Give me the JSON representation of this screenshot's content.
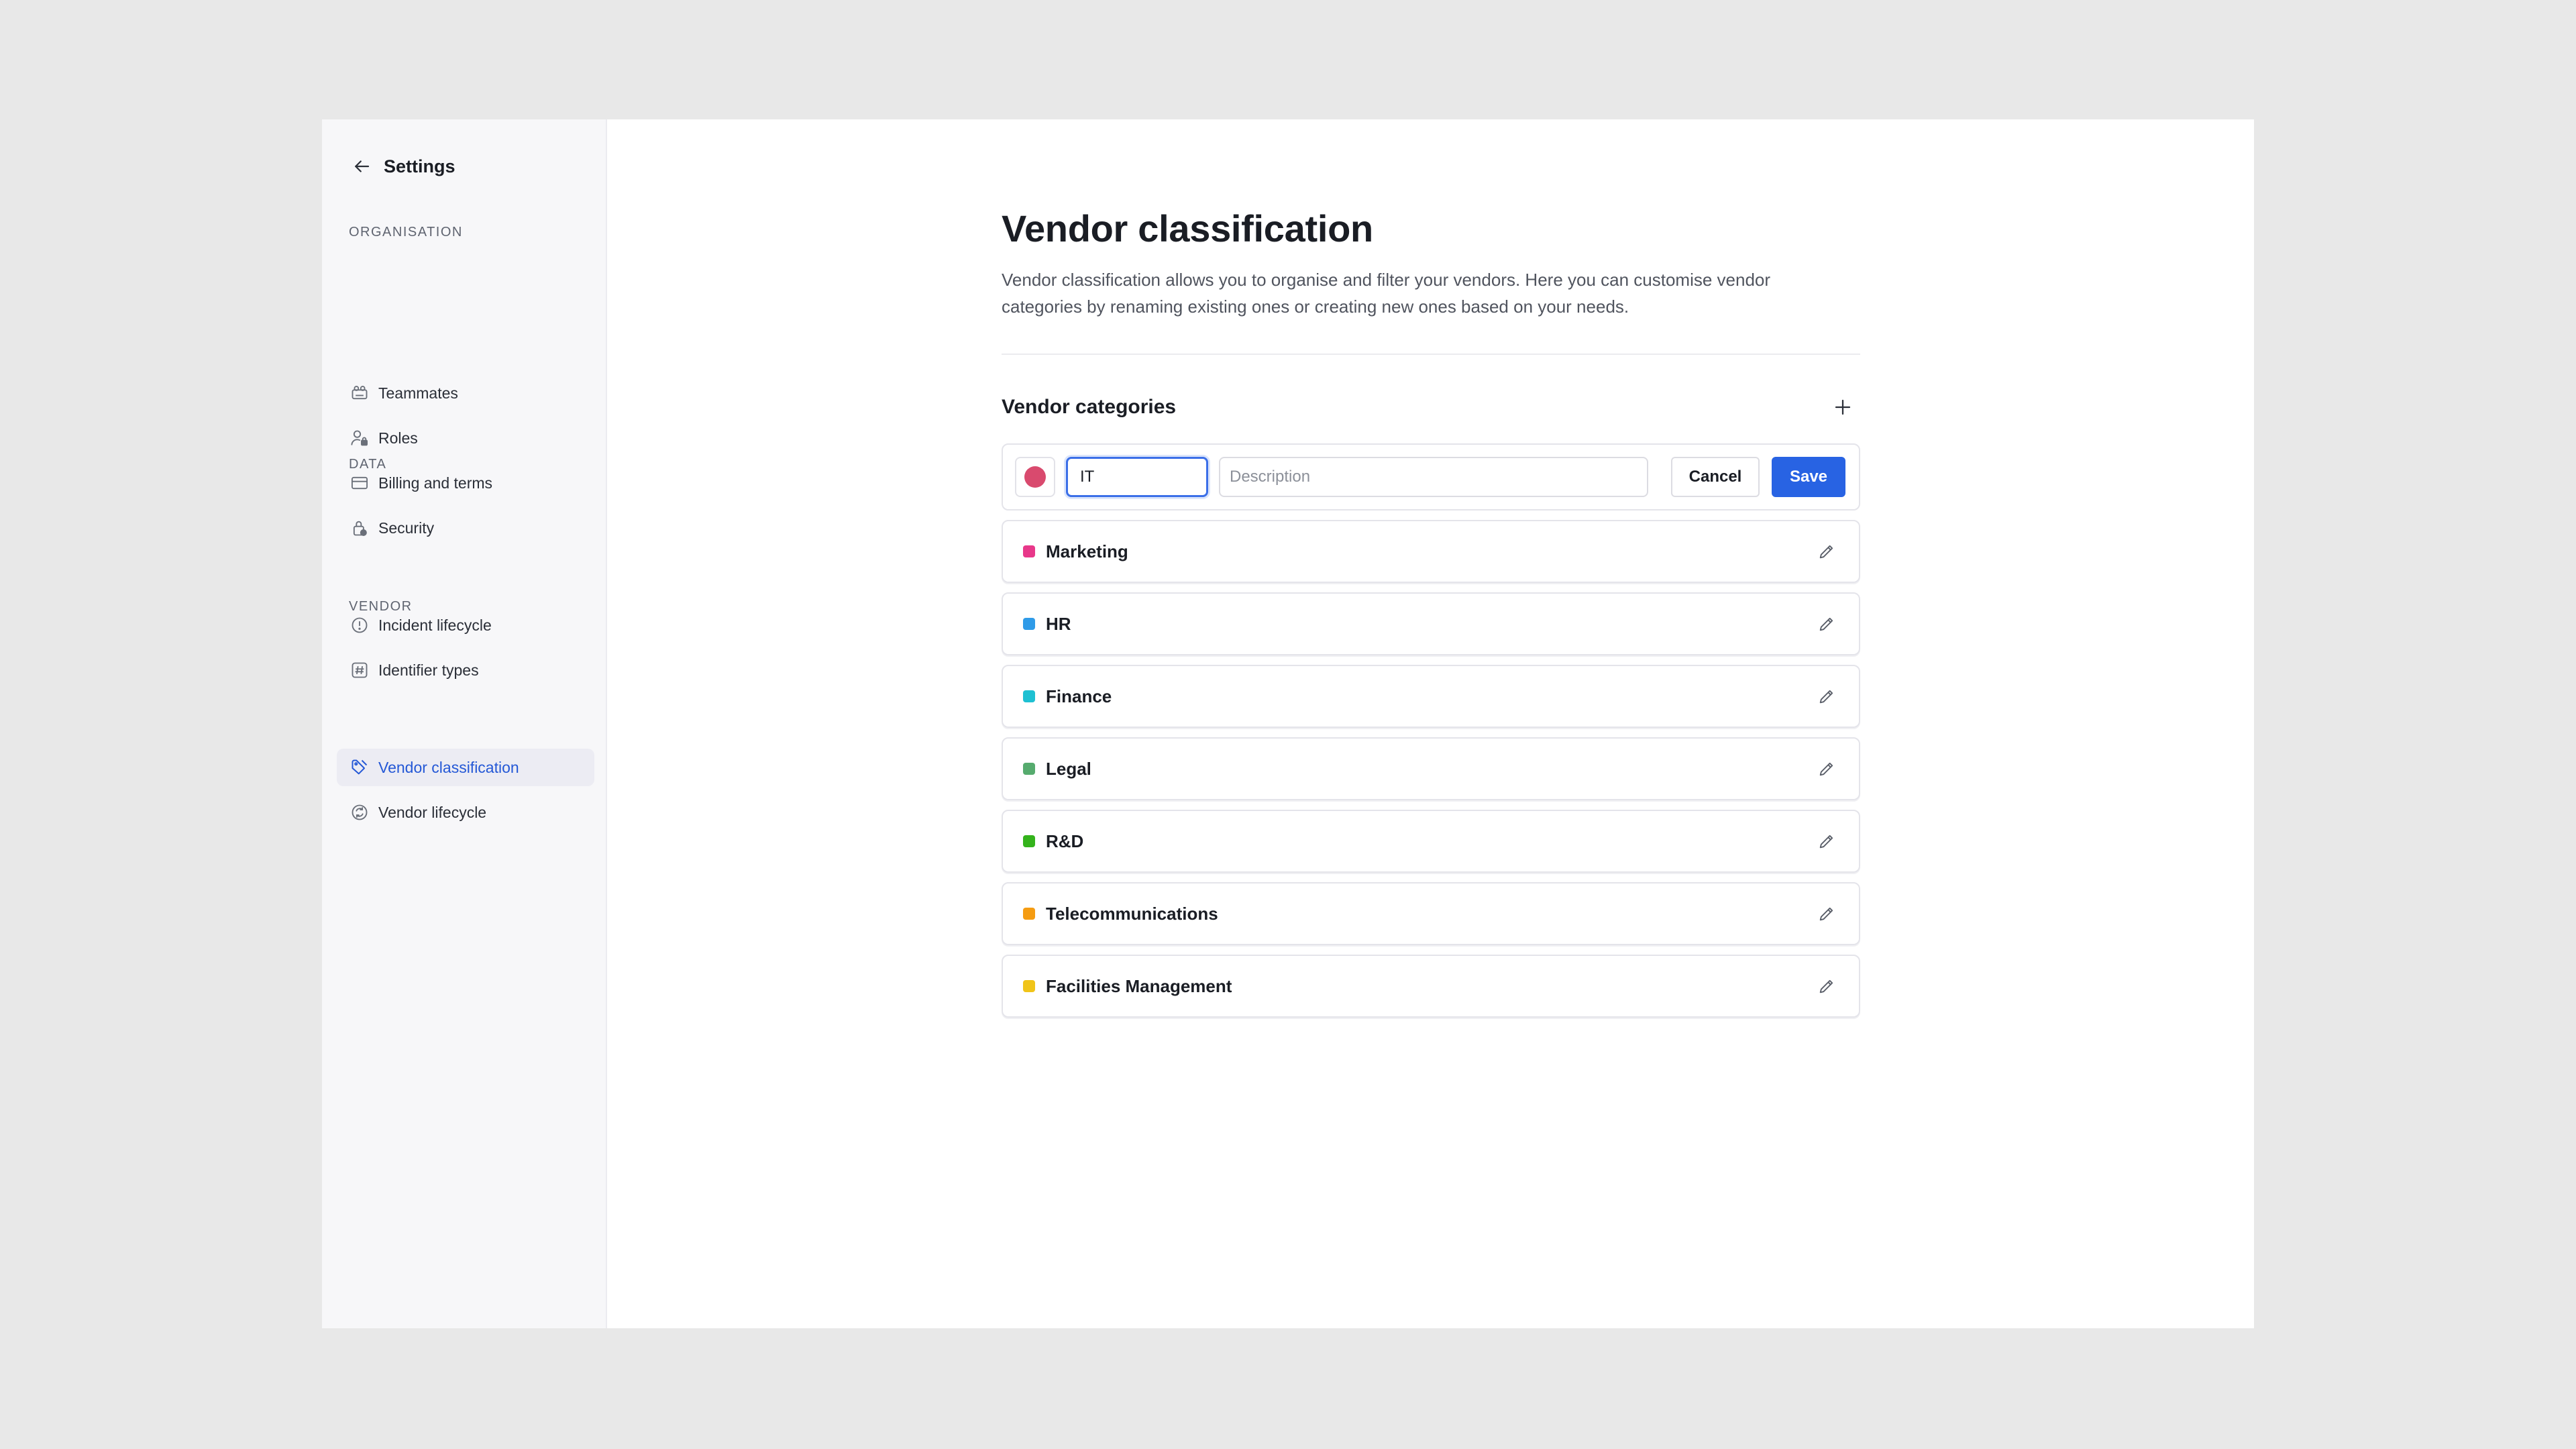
{
  "sidebar": {
    "back_label": "Settings",
    "sections": [
      {
        "label": "ORGANISATION",
        "items": [
          {
            "label": "Teammates",
            "icon": "teammates-icon"
          },
          {
            "label": "Roles",
            "icon": "user-lock-icon"
          },
          {
            "label": "Billing and terms",
            "icon": "credit-card-icon"
          },
          {
            "label": "Security",
            "icon": "lock-icon"
          }
        ]
      },
      {
        "label": "DATA",
        "items": [
          {
            "label": "Incident lifecycle",
            "icon": "alert-circle-icon"
          },
          {
            "label": "Identifier types",
            "icon": "hash-icon"
          }
        ]
      },
      {
        "label": "VENDOR",
        "items": [
          {
            "label": "Vendor classification",
            "icon": "tag-icon",
            "active": true
          },
          {
            "label": "Vendor lifecycle",
            "icon": "cycle-icon"
          }
        ]
      }
    ]
  },
  "main": {
    "title": "Vendor classification",
    "description": "Vendor classification allows you to organise and filter your vendors. Here you can customise vendor categories by renaming existing ones or creating new ones based on your needs.",
    "categories_title": "Vendor categories",
    "edit_row": {
      "color": "#d94a6e",
      "name_value": "IT",
      "description_placeholder": "Description",
      "cancel_label": "Cancel",
      "save_label": "Save"
    },
    "categories": [
      {
        "name": "Marketing",
        "color": "#e8388a"
      },
      {
        "name": "HR",
        "color": "#2f9be8"
      },
      {
        "name": "Finance",
        "color": "#1ec0d2"
      },
      {
        "name": "Legal",
        "color": "#56ab6e"
      },
      {
        "name": "R&D",
        "color": "#34b31c"
      },
      {
        "name": "Telecommunications",
        "color": "#f59c12"
      },
      {
        "name": "Facilities Management",
        "color": "#f0c419"
      }
    ]
  }
}
